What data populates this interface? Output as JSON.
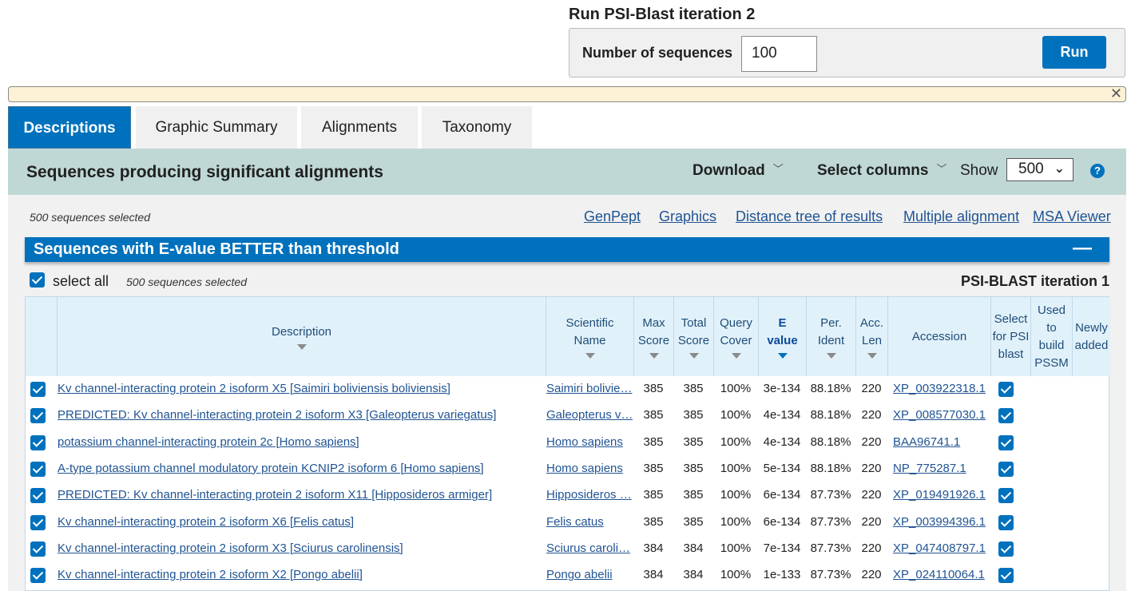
{
  "run": {
    "title": "Run PSI-Blast iteration 2",
    "label": "Number of sequences",
    "value": "100",
    "button": "Run"
  },
  "banner": {
    "close": "✕"
  },
  "tabs": [
    {
      "label": "Descriptions",
      "active": true
    },
    {
      "label": "Graphic Summary",
      "active": false
    },
    {
      "label": "Alignments",
      "active": false
    },
    {
      "label": "Taxonomy",
      "active": false
    }
  ],
  "header": {
    "title": "Sequences producing significant alignments",
    "download": "Download",
    "select_columns": "Select columns",
    "show_label": "Show",
    "show_value": "500",
    "help": "?"
  },
  "toolbar": {
    "selected_count": "500 sequences selected",
    "links": [
      "GenPept",
      "Graphics",
      "Distance tree of results",
      "Multiple alignment",
      "MSA Viewer"
    ]
  },
  "section": {
    "title": "Sequences with E-value BETTER than threshold",
    "collapse": "—",
    "select_all": "select all",
    "selected_count": "500 sequences selected",
    "iteration": "PSI-BLAST iteration 1"
  },
  "columns": [
    {
      "label": "Description"
    },
    {
      "label": "Scientific Name"
    },
    {
      "label": "Max Score"
    },
    {
      "label": "Total Score"
    },
    {
      "label": "Query Cover"
    },
    {
      "label": "E value"
    },
    {
      "label": "Per. Ident"
    },
    {
      "label": "Acc. Len"
    },
    {
      "label": "Accession"
    },
    {
      "label": "Select for PSI blast"
    },
    {
      "label": "Used to build PSSM"
    },
    {
      "label": "Newly added"
    }
  ],
  "rows": [
    {
      "desc": "Kv channel-interacting protein 2 isoform X5 [Saimiri boliviensis boliviensis]",
      "sci": "Saimiri bolivie…",
      "max": "385",
      "total": "385",
      "cover": "100%",
      "evalue": "3e-134",
      "ident": "88.18%",
      "len": "220",
      "acc": "XP_003922318.1"
    },
    {
      "desc": "PREDICTED: Kv channel-interacting protein 2 isoform X3 [Galeopterus variegatus]",
      "sci": "Galeopterus v…",
      "max": "385",
      "total": "385",
      "cover": "100%",
      "evalue": "4e-134",
      "ident": "88.18%",
      "len": "220",
      "acc": "XP_008577030.1"
    },
    {
      "desc": "potassium channel-interacting protein 2c [Homo sapiens]",
      "sci": "Homo sapiens",
      "max": "385",
      "total": "385",
      "cover": "100%",
      "evalue": "4e-134",
      "ident": "88.18%",
      "len": "220",
      "acc": "BAA96741.1"
    },
    {
      "desc": "A-type potassium channel modulatory protein KCNIP2 isoform 6 [Homo sapiens]",
      "sci": "Homo sapiens",
      "max": "385",
      "total": "385",
      "cover": "100%",
      "evalue": "5e-134",
      "ident": "88.18%",
      "len": "220",
      "acc": "NP_775287.1"
    },
    {
      "desc": "PREDICTED: Kv channel-interacting protein 2 isoform X11 [Hipposideros armiger]",
      "sci": "Hipposideros …",
      "max": "385",
      "total": "385",
      "cover": "100%",
      "evalue": "6e-134",
      "ident": "87.73%",
      "len": "220",
      "acc": "XP_019491926.1"
    },
    {
      "desc": "Kv channel-interacting protein 2 isoform X6 [Felis catus]",
      "sci": "Felis catus",
      "max": "385",
      "total": "385",
      "cover": "100%",
      "evalue": "6e-134",
      "ident": "87.73%",
      "len": "220",
      "acc": "XP_003994396.1"
    },
    {
      "desc": "Kv channel-interacting protein 2 isoform X3 [Sciurus carolinensis]",
      "sci": "Sciurus caroli…",
      "max": "384",
      "total": "384",
      "cover": "100%",
      "evalue": "7e-134",
      "ident": "87.73%",
      "len": "220",
      "acc": "XP_047408797.1"
    },
    {
      "desc": "Kv channel-interacting protein 2 isoform X2 [Pongo abelii]",
      "sci": "Pongo abelii",
      "max": "384",
      "total": "384",
      "cover": "100%",
      "evalue": "1e-133",
      "ident": "87.73%",
      "len": "220",
      "acc": "XP_024110064.1"
    }
  ]
}
